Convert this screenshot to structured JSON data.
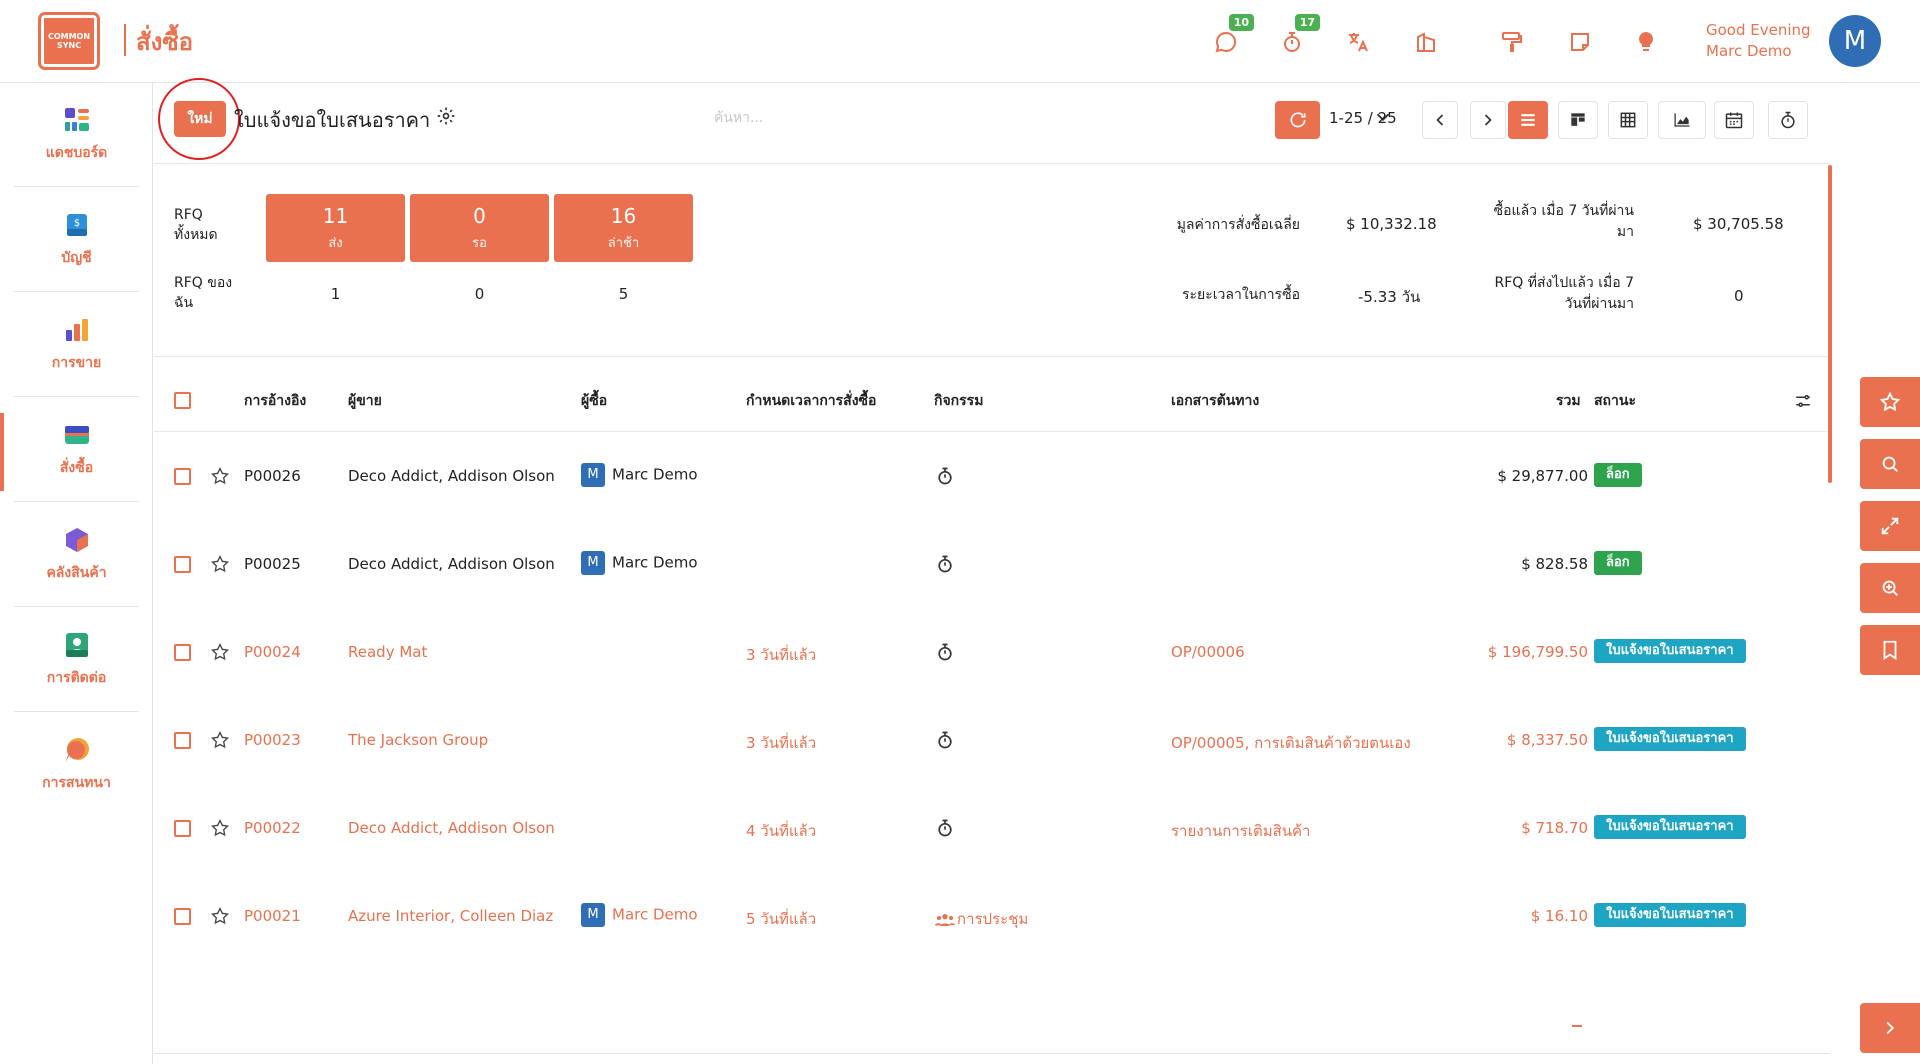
{
  "header": {
    "logo_text": "COMMON SYNC",
    "app_title": "สั่งซื้อ",
    "messages_badge": "10",
    "activities_badge": "17",
    "greeting": "Good Evening",
    "user_name": "Marc Demo",
    "avatar_letter": "M"
  },
  "sidebar": {
    "items": [
      {
        "label": "แดชบอร์ด"
      },
      {
        "label": "บัญชี"
      },
      {
        "label": "การขาย"
      },
      {
        "label": "สั่งซื้อ"
      },
      {
        "label": "คลังสินค้า"
      },
      {
        "label": "การติดต่อ"
      },
      {
        "label": "การสนทนา"
      }
    ]
  },
  "control": {
    "new_label": "ใหม่",
    "title": "ใบแจ้งขอใบเสนอราคา",
    "search_placeholder": "ค้นหา...",
    "pager": "1-25 / 25"
  },
  "dashboard": {
    "all_rfq_label": "RFQ ทั้งหมด",
    "my_rfq_label": "RFQ ของฉัน",
    "tiles": [
      {
        "num": "11",
        "label": "ส่ง",
        "mine": "1"
      },
      {
        "num": "0",
        "label": "รอ",
        "mine": "0"
      },
      {
        "num": "16",
        "label": "ล่าช้า",
        "mine": "5"
      }
    ],
    "avg_order_label": "มูลค่าการสั่งซื้อเฉลี่ย",
    "avg_order_value": "$ 10,332.18",
    "lead_time_label": "ระยะเวลาในการซื้อ",
    "lead_time_value": "-5.33 วัน",
    "purchased_7d_label_1": "ซื้อแล้ว เมื่อ 7 วันที่ผ่าน",
    "purchased_7d_label_2": "มา",
    "purchased_7d_value": "$ 30,705.58",
    "rfq_sent_7d_label_1": "RFQ ที่ส่งไปแล้ว เมื่อ 7",
    "rfq_sent_7d_label_2": "วันที่ผ่านมา",
    "rfq_sent_7d_value": "0"
  },
  "table": {
    "headers": {
      "reference": "การอ้างอิง",
      "vendor": "ผู้ขาย",
      "buyer": "ผู้ซื้อ",
      "deadline": "กำหนดเวลาการสั่งซื้อ",
      "activity": "กิจกรรม",
      "source": "เอกสารต้นทาง",
      "total": "รวม",
      "status": "สถานะ"
    },
    "rows": [
      {
        "ref": "P00026",
        "vendor": "Deco Addict, Addison Olson",
        "buyer": "Marc Demo",
        "deadline": "",
        "activity": "",
        "source": "",
        "total": "$ 29,877.00",
        "status": "ล็อก"
      },
      {
        "ref": "P00025",
        "vendor": "Deco Addict, Addison Olson",
        "buyer": "Marc Demo",
        "deadline": "",
        "activity": "",
        "source": "",
        "total": "$ 828.58",
        "status": "ล็อก"
      },
      {
        "ref": "P00024",
        "vendor": "Ready Mat",
        "buyer": "",
        "deadline": "3 วันที่แล้ว",
        "activity": "",
        "source": "OP/00006",
        "total": "$ 196,799.50",
        "status": "ใบแจ้งขอใบเสนอราคา"
      },
      {
        "ref": "P00023",
        "vendor": "The Jackson Group",
        "buyer": "",
        "deadline": "3 วันที่แล้ว",
        "activity": "",
        "source": "OP/00005, การเติมสินค้าด้วยตนเอง",
        "total": "$ 8,337.50",
        "status": "ใบแจ้งขอใบเสนอราคา"
      },
      {
        "ref": "P00022",
        "vendor": "Deco Addict, Addison Olson",
        "buyer": "",
        "deadline": "4 วันที่แล้ว",
        "activity": "",
        "source": "รายงานการเติมสินค้า",
        "total": "$ 718.70",
        "status": "ใบแจ้งขอใบเสนอราคา"
      },
      {
        "ref": "P00021",
        "vendor": "Azure Interior, Colleen Diaz",
        "buyer": "Marc Demo",
        "deadline": "5 วันที่แล้ว",
        "activity": "การประชุม",
        "source": "",
        "total": "$ 16.10",
        "status": "ใบแจ้งขอใบเสนอราคา"
      }
    ]
  }
}
